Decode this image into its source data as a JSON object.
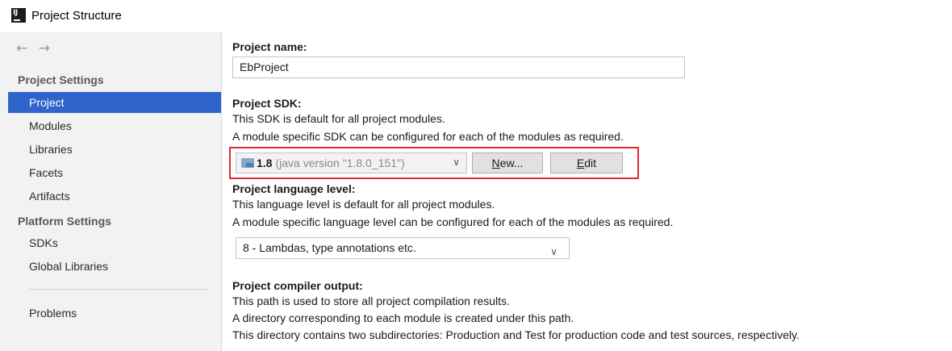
{
  "window": {
    "title": "Project Structure",
    "logo_text": "IJ"
  },
  "sidebar": {
    "nav": {
      "back": "←",
      "forward": "→"
    },
    "groups": {
      "project_settings": "Project Settings",
      "platform_settings": "Platform Settings"
    },
    "items": {
      "project": "Project",
      "modules": "Modules",
      "libraries": "Libraries",
      "facets": "Facets",
      "artifacts": "Artifacts",
      "sdks": "SDKs",
      "global_libraries": "Global Libraries",
      "problems": "Problems"
    },
    "selected": "Project"
  },
  "main": {
    "project_name": {
      "label": "Project name:",
      "value": "EbProject"
    },
    "project_sdk": {
      "label": "Project SDK:",
      "line1": "This SDK is default for all project modules.",
      "line2": "A module specific SDK can be configured for each of the modules as required.",
      "selected_version": "1.8",
      "selected_detail": "(java version \"1.8.0_151\")",
      "chevron": "∨",
      "new_button": {
        "mnemonic": "N",
        "rest": "ew..."
      },
      "edit_button": {
        "mnemonic": "E",
        "rest": "dit"
      }
    },
    "language_level": {
      "label": "Project language level:",
      "line1": "This language level is default for all project modules.",
      "line2": "A module specific language level can be configured for each of the modules as required.",
      "value": "8 - Lambdas, type annotations etc.",
      "chevron": "∨"
    },
    "compiler_output": {
      "label": "Project compiler output:",
      "line1": "This path is used to store all project compilation results.",
      "line2": "A directory corresponding to each module is created under this path.",
      "line3": "This directory contains two subdirectories: Production and Test for production code and test sources, respectively."
    }
  },
  "colors": {
    "selection": "#2f65ca",
    "highlight_border": "#e0282f",
    "sidebar_bg": "#f2f2f2"
  }
}
